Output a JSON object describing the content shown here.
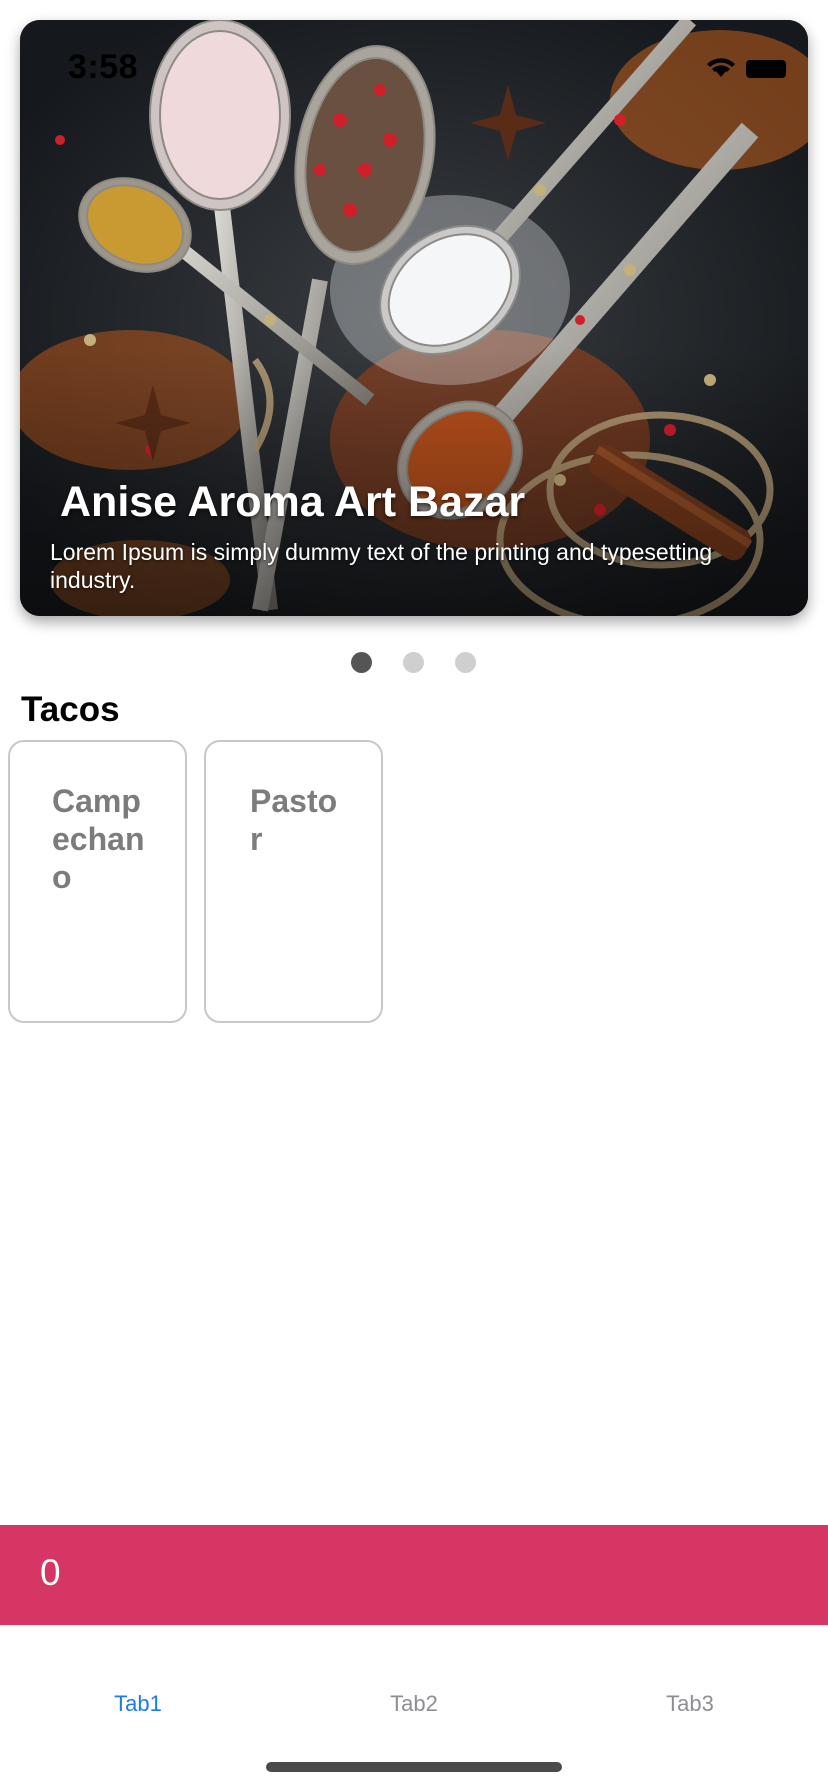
{
  "status_bar": {
    "time": "3:58",
    "wifi_icon": "wifi-icon",
    "battery_icon": "battery-icon"
  },
  "carousel": {
    "slides": [
      {
        "title": "Anise Aroma Art Bazar",
        "description": "Lorem Ipsum is simply dummy text of the printing and typesetting industry.",
        "image": "spices-photo"
      }
    ],
    "page_count": 3,
    "active_index": 0,
    "colors": {
      "dot_active": "#555555",
      "dot_inactive": "#cfcfcf"
    }
  },
  "section": {
    "title": "Tacos",
    "items": [
      {
        "label": "Campechano"
      },
      {
        "label": "Pastor"
      }
    ]
  },
  "counter": {
    "value": "0",
    "color": "#d63663"
  },
  "tabbar": {
    "tabs": [
      {
        "label": "Tab1",
        "active": true
      },
      {
        "label": "Tab2",
        "active": false
      },
      {
        "label": "Tab3",
        "active": false
      }
    ],
    "colors": {
      "active": "#1a7bea",
      "inactive": "#8e8e93"
    }
  }
}
